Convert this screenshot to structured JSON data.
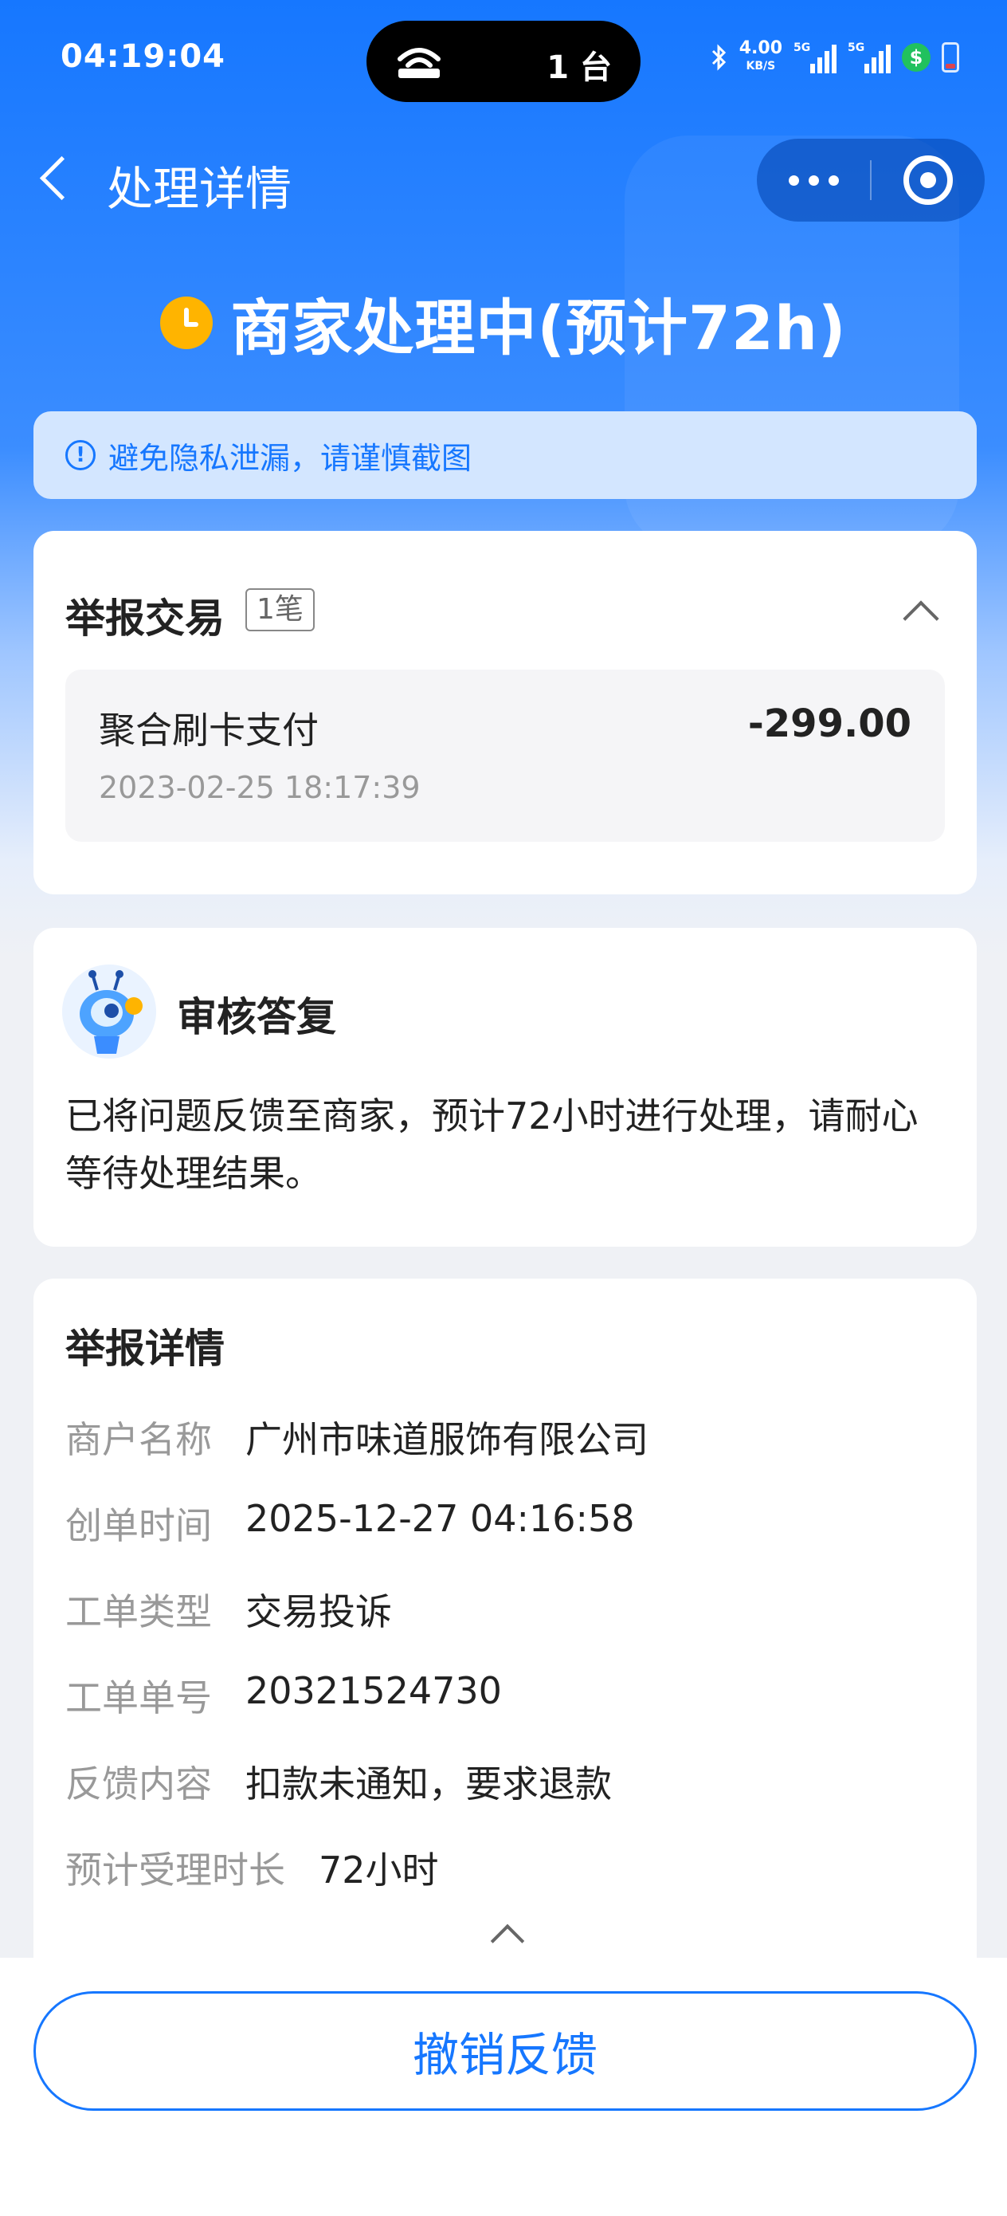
{
  "status_bar": {
    "time": "04:19:04",
    "island_devices": "1 台",
    "net_speed": "4.00",
    "net_speed_unit": "KB/S",
    "signal_1_label": "5G",
    "signal_2_label": "5G",
    "money_icon": "$"
  },
  "nav": {
    "title": "处理详情"
  },
  "status": {
    "text": "商家处理中(预计72h)"
  },
  "notice": {
    "icon": "!",
    "text": "避免隐私泄漏，请谨慎截图"
  },
  "report": {
    "title": "举报交易",
    "count": "1笔",
    "item": {
      "name": "聚合刷卡支付",
      "amount": "-299.00",
      "time": "2023-02-25 18:17:39"
    }
  },
  "reply": {
    "title": "审核答复",
    "text": "已将问题反馈至商家，预计72小时进行处理，请耐心等待处理结果。"
  },
  "detail": {
    "title": "举报详情",
    "rows": [
      {
        "key": "商户名称",
        "value": "广州市味道服饰有限公司"
      },
      {
        "key": "创单时间",
        "value": "2025-12-27 04:16:58"
      },
      {
        "key": "工单类型",
        "value": "交易投诉"
      },
      {
        "key": "工单单号",
        "value": "20321524730"
      },
      {
        "key": "反馈内容",
        "value": "扣款未通知，要求退款"
      },
      {
        "key": "预计受理时长",
        "value": "72小时"
      }
    ]
  },
  "bottom": {
    "revoke_label": "撤销反馈"
  },
  "colors": {
    "brand": "#1677ff",
    "pending": "#ffb400"
  }
}
